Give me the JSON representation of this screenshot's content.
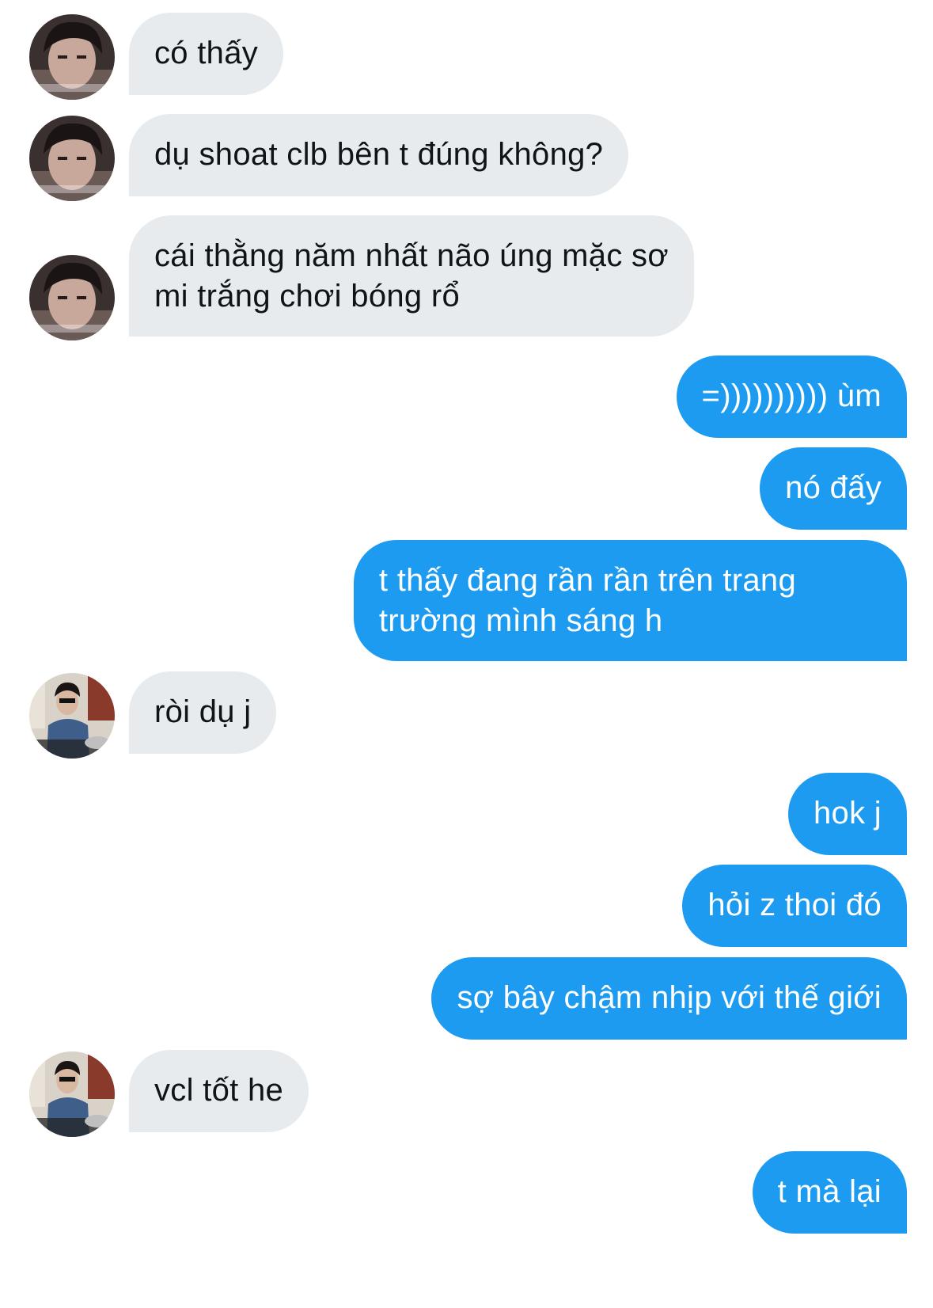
{
  "conversation": {
    "messages": [
      {
        "direction": "in",
        "avatar": "avatar-a",
        "lines": [
          "có thấy"
        ]
      },
      {
        "direction": "in",
        "avatar": "avatar-a",
        "lines": [
          "dụ shoat clb bên t đúng không?"
        ]
      },
      {
        "direction": "in",
        "avatar": "avatar-a",
        "lines": [
          "cái thằng năm nhất não úng mặc sơ",
          "mi trắng chơi bóng rổ"
        ]
      },
      {
        "direction": "out",
        "lines": [
          "=)))))))))) ùm"
        ]
      },
      {
        "direction": "out",
        "lines": [
          "nó đấy"
        ]
      },
      {
        "direction": "out",
        "lines": [
          "t thấy đang rần rần trên trang",
          "trường mình sáng h"
        ]
      },
      {
        "direction": "in",
        "avatar": "avatar-b",
        "lines": [
          "ròi dụ j"
        ]
      },
      {
        "direction": "out",
        "lines": [
          "hok j"
        ]
      },
      {
        "direction": "out",
        "lines": [
          "hỏi z thoi đó"
        ]
      },
      {
        "direction": "out",
        "lines": [
          "sợ bây chậm nhịp với thế giới"
        ]
      },
      {
        "direction": "in",
        "avatar": "avatar-b",
        "lines": [
          "vcl tốt he"
        ]
      },
      {
        "direction": "out",
        "lines": [
          "t mà lại"
        ]
      }
    ]
  },
  "colors": {
    "incoming_bubble": "#e7ebee",
    "incoming_text": "#0f1419",
    "outgoing_bubble": "#1d9bf0",
    "outgoing_text": "#ffffff"
  }
}
